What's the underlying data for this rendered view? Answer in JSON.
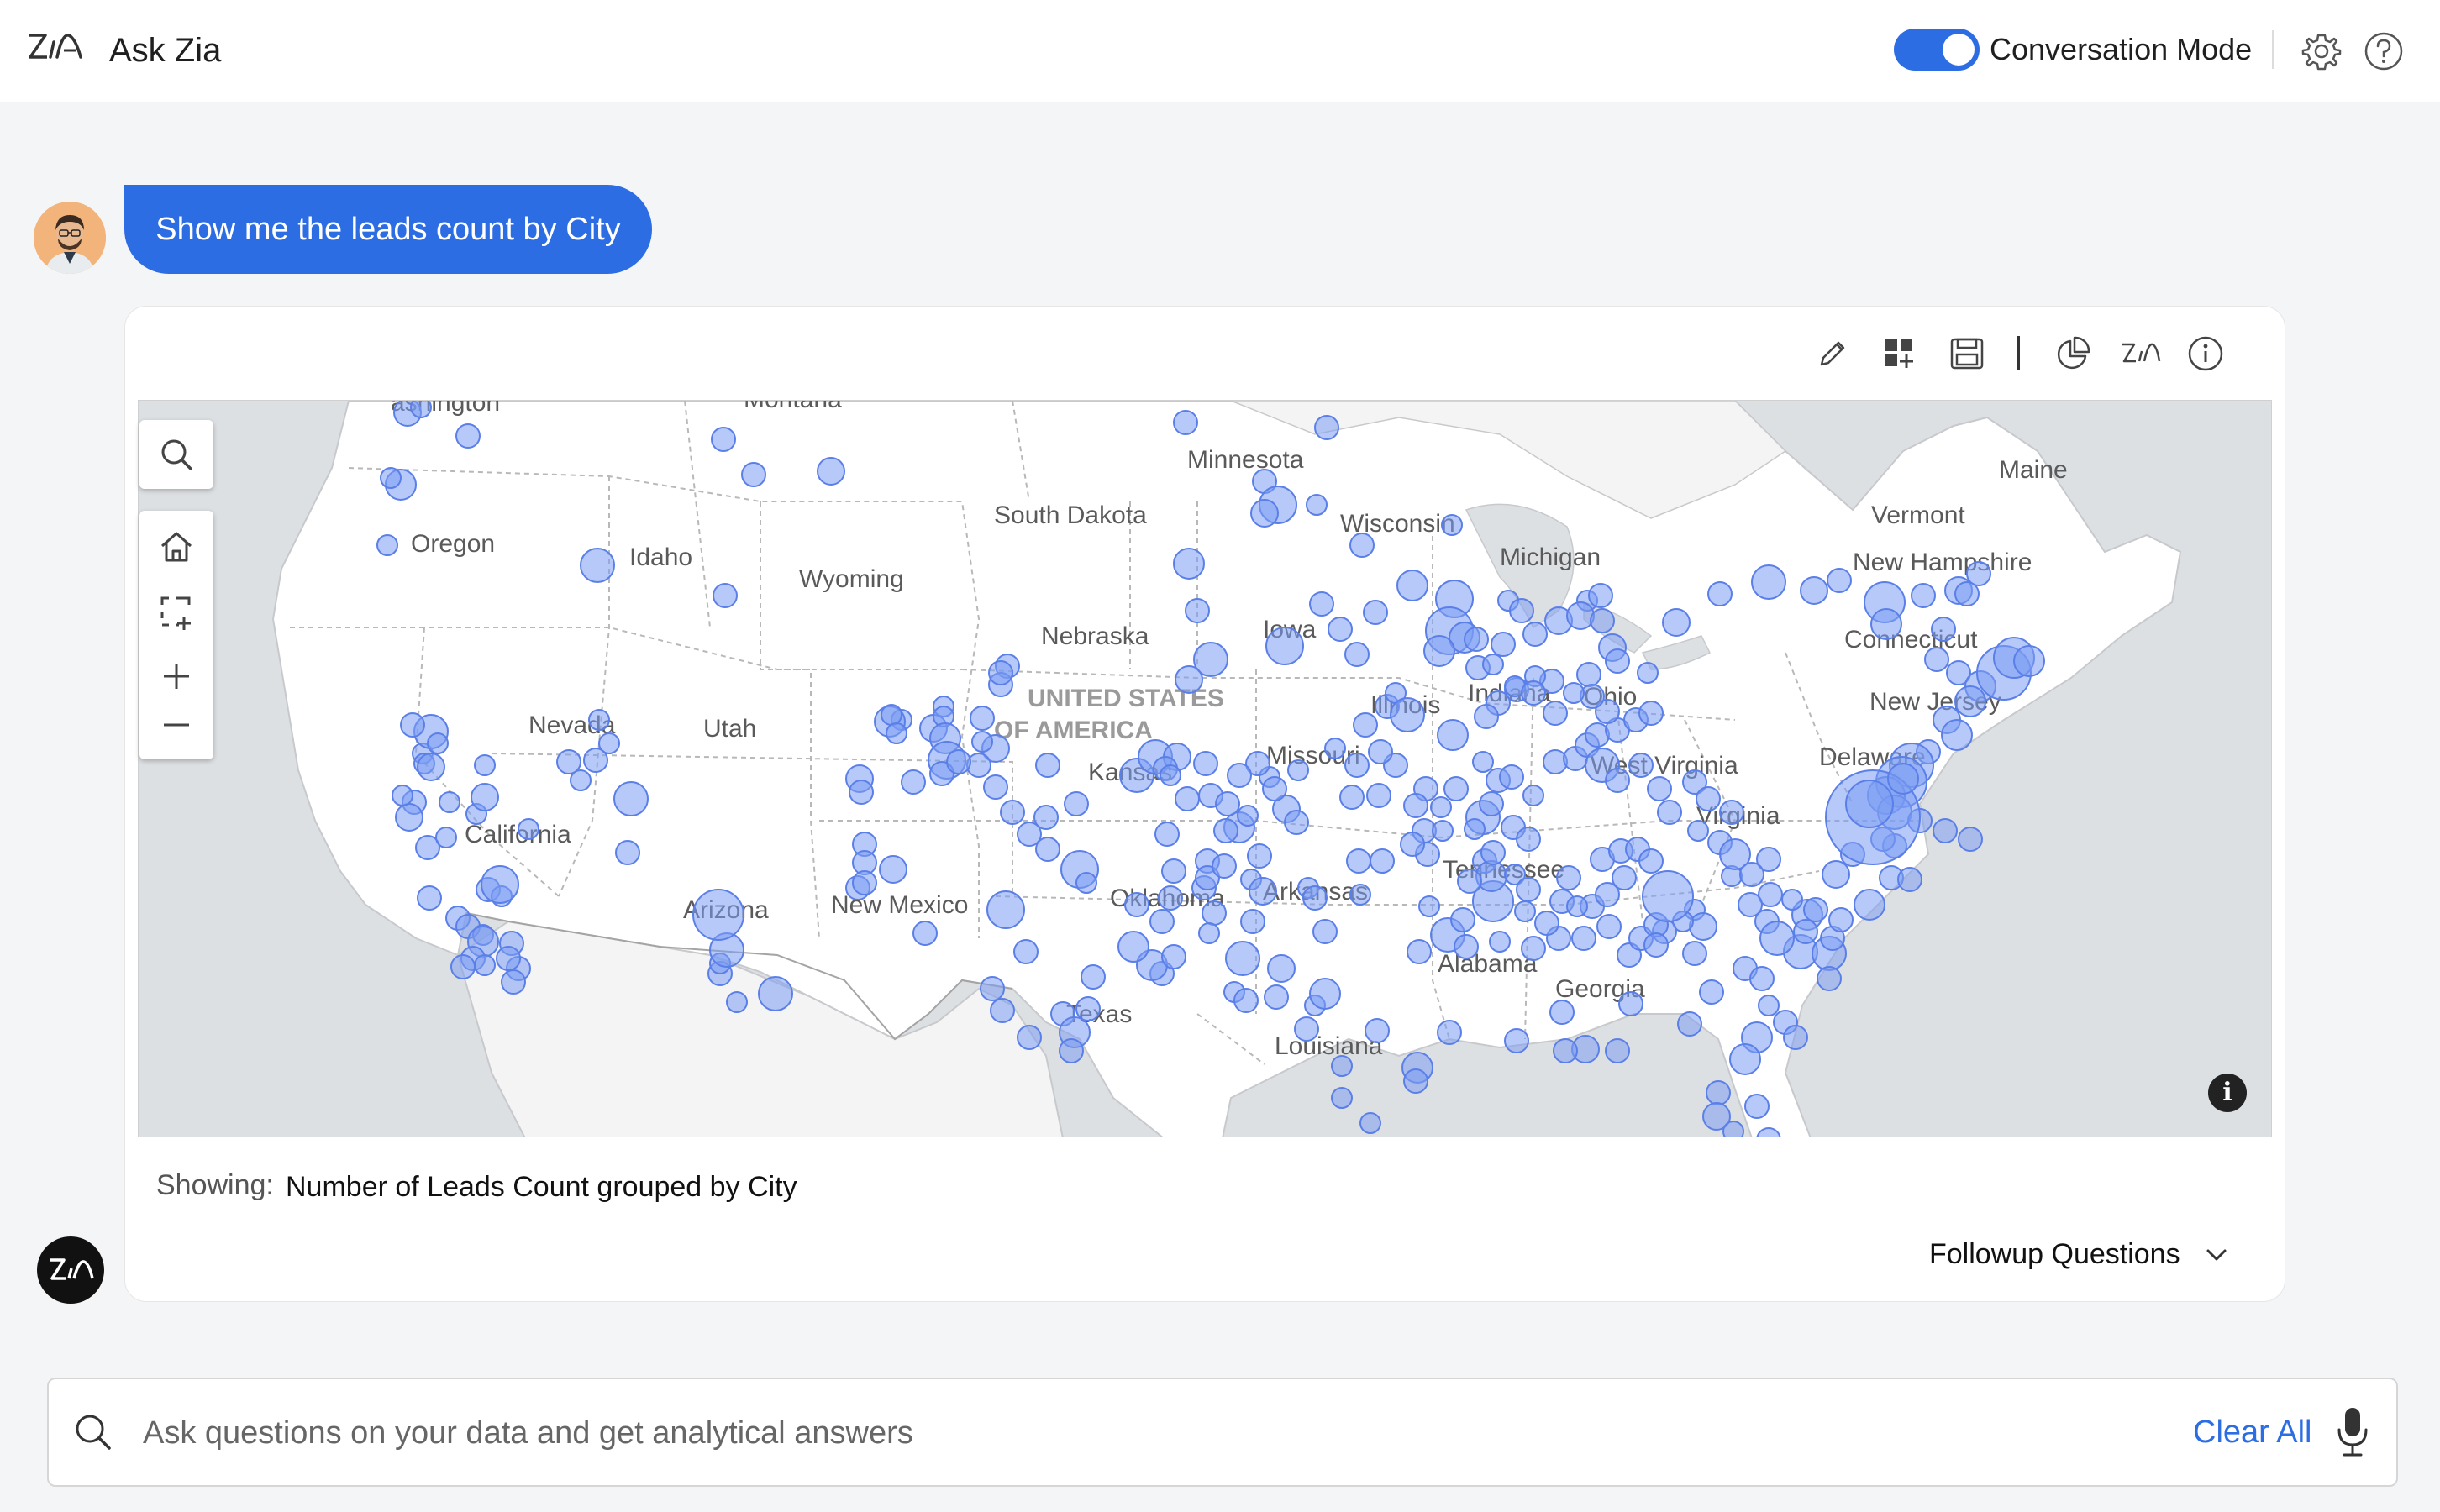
{
  "header": {
    "app_title": "Ask Zia",
    "conversation_mode_label": "Conversation Mode",
    "conversation_mode_on": true,
    "icons": [
      "zia-logo-icon",
      "gear-icon",
      "help-icon"
    ]
  },
  "colors": {
    "accent": "#2d6de3",
    "bubble_fill": "#7b9cf2",
    "bubble_stroke": "#5b7fe8",
    "land": "#ffffff",
    "water": "#dde0e3"
  },
  "conversation": {
    "user_message": "Show me the leads count by City"
  },
  "toolbar": {
    "icons": [
      "edit-icon",
      "add-to-dashboard-icon",
      "save-icon",
      "chart-type-icon",
      "zia-insights-icon",
      "info-icon"
    ]
  },
  "map": {
    "state_labels": [
      "ashington",
      "Montana",
      "Minnesota",
      "Maine",
      "Oregon",
      "Idaho",
      "Wyoming",
      "South Dakota",
      "Wisconsin",
      "Vermont",
      "Michigan",
      "New Hampshire",
      "Nebraska",
      "Iowa",
      "Connecticut",
      "Nevada",
      "Utah",
      "UNITED STATES",
      "OF AMERICA",
      "Illinois",
      "Indiana",
      "Ohio",
      "New Jersey",
      "Kansas",
      "Missouri",
      "West Virginia",
      "Delaware",
      "California",
      "Virginia",
      "Tennessee",
      "Arizona",
      "New Mexico",
      "Oklahoma",
      "Arkansas",
      "Alabama",
      "Georgia",
      "Texas",
      "Louisiana"
    ],
    "controls": [
      "search-icon",
      "home-icon",
      "zoom-select-icon",
      "zoom-in-icon",
      "zoom-out-icon"
    ]
  },
  "chart_data": {
    "type": "scatter",
    "description_kind": "bubble map of lead counts by city",
    "x": [],
    "series": []
  },
  "summary": {
    "showing_label": "Showing:",
    "showing_value": "Number of Leads Count grouped by City",
    "followup_label": "Followup Questions"
  },
  "input": {
    "placeholder": "Ask questions on your data and get analytical answers",
    "value": "",
    "clear_all_label": "Clear All"
  }
}
